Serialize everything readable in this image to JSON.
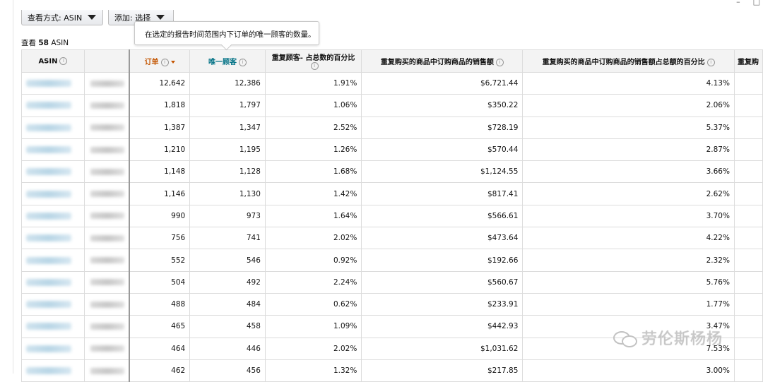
{
  "toolbar": {
    "view_label": "查看方式: ASIN",
    "add_label": "添加: 选择"
  },
  "tooltip": {
    "text": "在选定的报告时间范围内下订单的唯一顾客的数量。"
  },
  "summary": {
    "prefix": "查看",
    "count": "58",
    "suffix": "ASIN"
  },
  "table": {
    "headers": {
      "asin": "ASIN",
      "name": "",
      "orders": "订单",
      "unique_customers": "唯一顾客",
      "repeat_pct_line1": "重复顾客- 占总数的百分比",
      "repeat_sales": "重复购买的商品中订购商品的销售额",
      "repeat_sales_pct": "重复购买的商品中订购商品的销售额占总额的百分比",
      "next_partial": "重复购"
    },
    "rows": [
      {
        "orders": "12,642",
        "unique": "12,386",
        "repeat_pct": "1.91%",
        "repeat_sales": "$6,721.44",
        "repeat_sales_pct": "4.13%"
      },
      {
        "orders": "1,818",
        "unique": "1,797",
        "repeat_pct": "1.06%",
        "repeat_sales": "$350.22",
        "repeat_sales_pct": "2.06%"
      },
      {
        "orders": "1,387",
        "unique": "1,347",
        "repeat_pct": "2.52%",
        "repeat_sales": "$728.19",
        "repeat_sales_pct": "5.37%"
      },
      {
        "orders": "1,210",
        "unique": "1,195",
        "repeat_pct": "1.26%",
        "repeat_sales": "$570.44",
        "repeat_sales_pct": "2.87%"
      },
      {
        "orders": "1,148",
        "unique": "1,128",
        "repeat_pct": "1.68%",
        "repeat_sales": "$1,124.55",
        "repeat_sales_pct": "3.66%"
      },
      {
        "orders": "1,146",
        "unique": "1,130",
        "repeat_pct": "1.42%",
        "repeat_sales": "$817.41",
        "repeat_sales_pct": "2.62%"
      },
      {
        "orders": "990",
        "unique": "973",
        "repeat_pct": "1.64%",
        "repeat_sales": "$566.61",
        "repeat_sales_pct": "3.70%"
      },
      {
        "orders": "756",
        "unique": "741",
        "repeat_pct": "2.02%",
        "repeat_sales": "$473.64",
        "repeat_sales_pct": "4.22%"
      },
      {
        "orders": "552",
        "unique": "546",
        "repeat_pct": "0.92%",
        "repeat_sales": "$192.66",
        "repeat_sales_pct": "2.32%"
      },
      {
        "orders": "504",
        "unique": "492",
        "repeat_pct": "2.24%",
        "repeat_sales": "$560.67",
        "repeat_sales_pct": "5.76%"
      },
      {
        "orders": "488",
        "unique": "484",
        "repeat_pct": "0.62%",
        "repeat_sales": "$233.91",
        "repeat_sales_pct": "1.77%"
      },
      {
        "orders": "465",
        "unique": "458",
        "repeat_pct": "1.09%",
        "repeat_sales": "$442.93",
        "repeat_sales_pct": "3.47%"
      },
      {
        "orders": "464",
        "unique": "446",
        "repeat_pct": "2.02%",
        "repeat_sales": "$1,031.62",
        "repeat_sales_pct": "7.53%"
      },
      {
        "orders": "462",
        "unique": "456",
        "repeat_pct": "1.32%",
        "repeat_sales": "$217.85",
        "repeat_sales_pct": "3.00%"
      }
    ]
  },
  "watermark": {
    "text": "劳伦斯杨杨",
    "icon": "wechat-icon"
  },
  "colors": {
    "orders_header": "#c45500",
    "unique_header": "#007185",
    "header_bg": "#f3f3f3"
  }
}
